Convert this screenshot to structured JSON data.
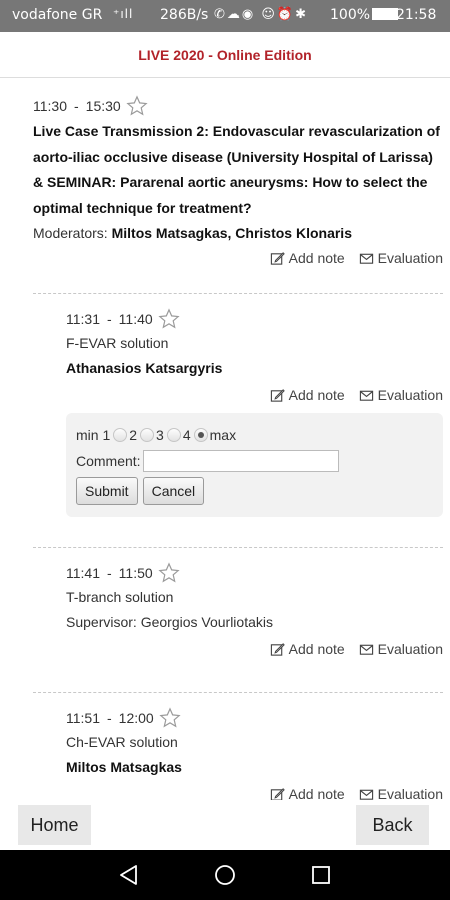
{
  "status_bar": {
    "carrier": "vodafone GR",
    "signal": "⁺ıll",
    "net_speed": "286B/s",
    "status_icons": "✆☁◉ ☺⏰✱",
    "battery": "100%",
    "time": "21:58"
  },
  "app_bar": {
    "title": "LIVE 2020 - Online Edition"
  },
  "session": {
    "time_start": "11:30",
    "time_end": "15:30",
    "separator": "-",
    "title": "Live Case Transmission 2: Endovascular revascularization of aorto-iliac occlusive disease (University Hospital of Larissa) & SEMINAR: Pararenal aortic aneurysms: How to select the optimal technique for treatment?",
    "moderators_label": "Moderators:",
    "moderators": "Miltos Matsagkas, Christos Klonaris"
  },
  "actions": {
    "add_note": "Add note",
    "evaluation": "Evaluation"
  },
  "talks": [
    {
      "time_start": "11:31",
      "time_end": "11:40",
      "title": "F-EVAR solution",
      "speaker": "Athanasios Katsargyris"
    },
    {
      "time_start": "11:41",
      "time_end": "11:50",
      "title": "T-branch solution",
      "supervisor": "Supervisor: Georgios Vourliotakis"
    },
    {
      "time_start": "11:51",
      "time_end": "12:00",
      "title": "Ch-EVAR solution",
      "speaker": "Miltos Matsagkas"
    }
  ],
  "evaluation_form": {
    "min_label": "min 1",
    "options": [
      "2",
      "3",
      "4"
    ],
    "max_label": "max",
    "selected": "max",
    "comment_label": "Comment:",
    "comment_value": "",
    "submit_label": "Submit",
    "cancel_label": "Cancel"
  },
  "bottom_nav": {
    "home_label": "Home",
    "back_label": "Back"
  },
  "colors": {
    "accent": "#b2232a",
    "status_bar": "#777777",
    "form_bg": "#f2f2f2"
  }
}
